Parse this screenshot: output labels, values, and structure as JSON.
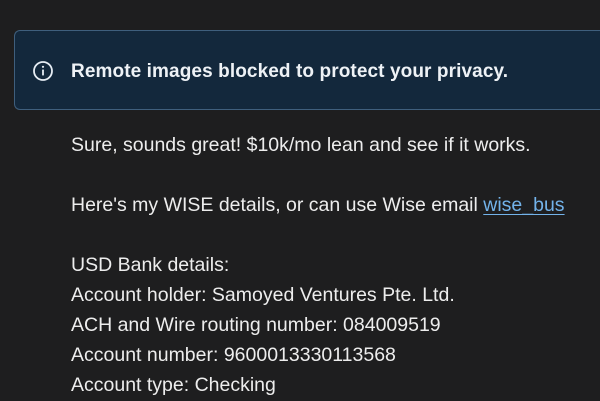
{
  "banner": {
    "icon": "info-circle-icon",
    "text": "Remote images blocked to protect your privacy."
  },
  "message": {
    "greeting": "Sure, sounds great! $10k/mo lean and see if it works.",
    "wise_intro": "Here's my WISE details, or can use Wise email ",
    "wise_email_visible": "wise_bus",
    "bank_heading": "USD Bank details:",
    "account_holder": "Account holder: Samoyed Ventures Pte. Ltd.",
    "routing": "ACH and Wire routing number: 084009519",
    "account_number": "Account number: 9600013330113568",
    "account_type": "Account type: Checking"
  },
  "colors": {
    "background": "#1e1e1f",
    "banner_bg": "#13283c",
    "banner_border": "#3f5f7d",
    "link": "#73b3ea"
  }
}
